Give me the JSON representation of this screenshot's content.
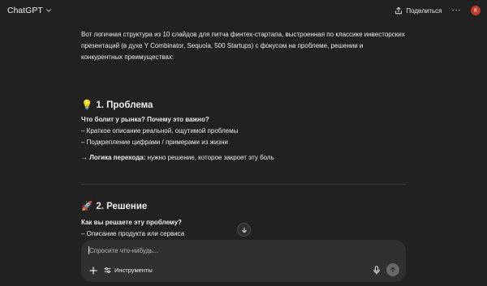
{
  "topbar": {
    "model_name": "ChatGPT",
    "share_label": "Поделиться",
    "more_label": "···",
    "avatar_letter": "К",
    "avatar_color": "#c0392b"
  },
  "message": {
    "intro": "Вот логичная структура из 10 слайдов для питча финтех-стартапа, выстроенная по классике инвесторских презентаций (в духе Y Combinator, Sequoia, 500 Startups) с фокусом на проблеме, решении и конкурентных преимуществах:",
    "section1": {
      "emoji": "💡",
      "title": "1. Проблема",
      "question": "Что болит у рынка? Почему это важно?",
      "bullets": [
        "– Краткое описание реальной, ощутимой проблемы",
        "– Подкрепление цифрами / примерами из жизни"
      ],
      "transition_arrow": "→",
      "transition_label": "Логика перехода:",
      "transition_text": "нужно решение, которое закроет эту боль"
    },
    "section2": {
      "emoji": "🚀",
      "title": "2. Решение",
      "question": "Как вы решаете эту проблему?",
      "bullets": [
        "– Описание продукта или сервиса"
      ]
    }
  },
  "composer": {
    "placeholder": "Спросите что-нибудь...",
    "tools_label": "Инструменты"
  }
}
